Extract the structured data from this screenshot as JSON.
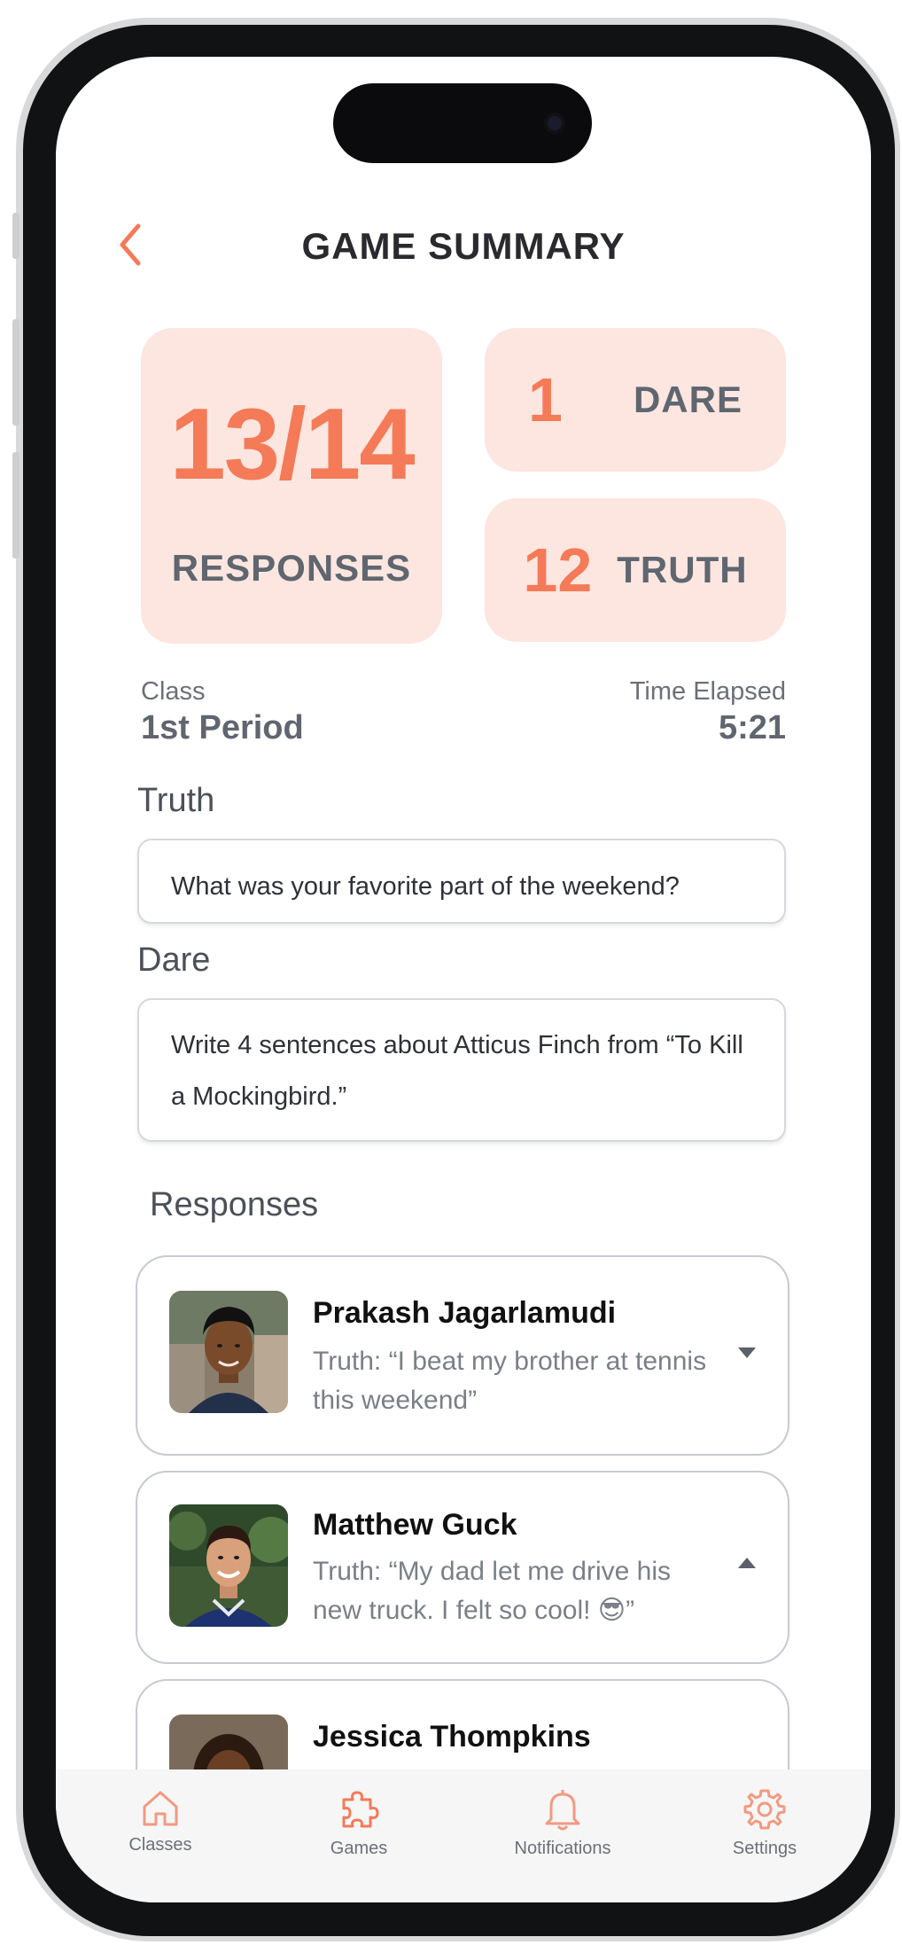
{
  "header": {
    "title": "GAME SUMMARY"
  },
  "stats": {
    "responses_value": "13/14",
    "responses_label": "RESPONSES",
    "dare_count": "1",
    "dare_label": "DARE",
    "truth_count": "12",
    "truth_label": "TRUTH"
  },
  "info": {
    "class_label": "Class",
    "class_value": "1st Period",
    "time_label": "Time Elapsed",
    "time_value": "5:21"
  },
  "prompts": {
    "truth_label": "Truth",
    "truth_text": "What was your favorite part of the weekend?",
    "dare_label": "Dare",
    "dare_text": "Write 4 sentences about Atticus Finch from “To Kill a Mockingbird.”"
  },
  "responses": {
    "label": "Responses",
    "items": [
      {
        "name": "Prakash Jagarlamudi",
        "text": "Truth: “I beat my brother at tennis this weekend”",
        "chevron": "chevron-down-icon"
      },
      {
        "name": "Matthew Guck",
        "text": "Truth: “My dad let me drive his new truck. I felt so cool! 😎”",
        "chevron": "chevron-up-icon"
      },
      {
        "name": "Jessica Thompkins",
        "text": "",
        "chevron": ""
      }
    ]
  },
  "nav": {
    "items": [
      {
        "label": "Classes",
        "icon": "home-icon"
      },
      {
        "label": "Games",
        "icon": "puzzle-icon"
      },
      {
        "label": "Notifications",
        "icon": "bell-icon"
      },
      {
        "label": "Settings",
        "icon": "gear-icon"
      }
    ]
  },
  "colors": {
    "accent": "#f57a57",
    "card_bg": "#fde6df",
    "text_dark": "#2a2a2e",
    "text_muted": "#5f6670"
  }
}
